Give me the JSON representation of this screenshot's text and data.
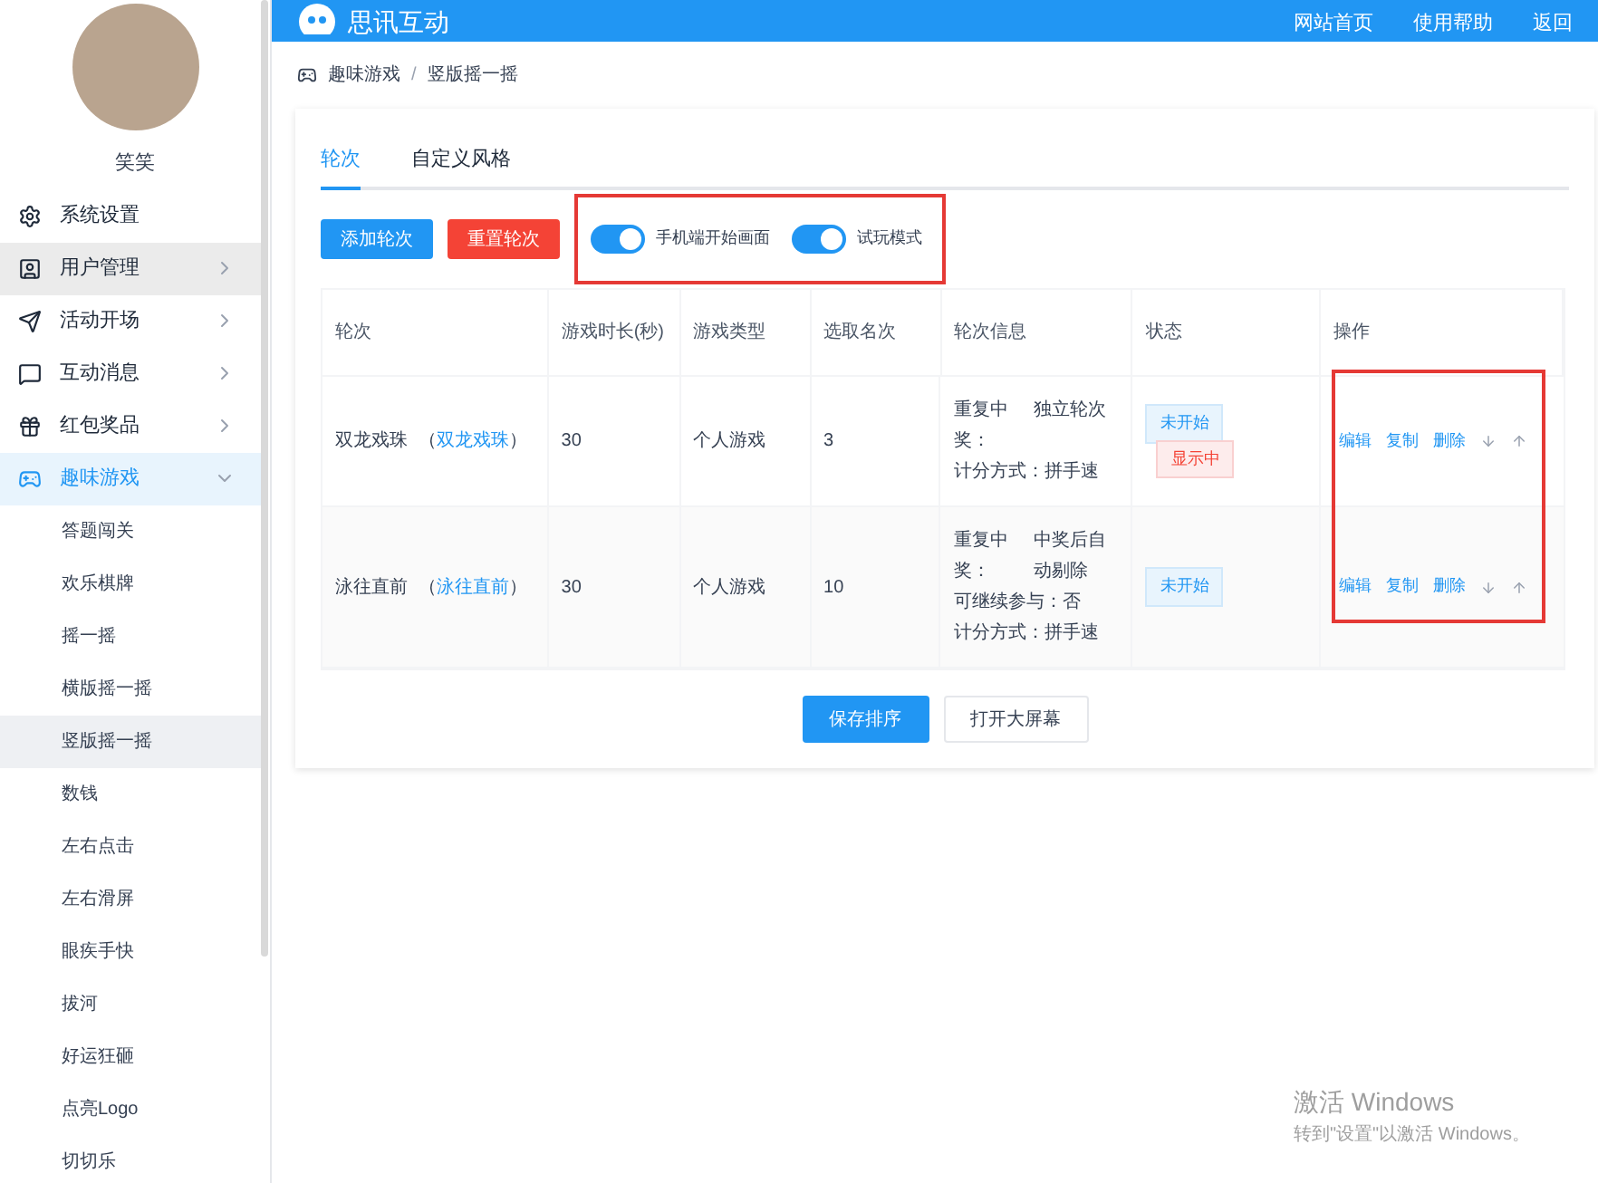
{
  "header": {
    "brand": "思讯互动",
    "links": [
      "网站首页",
      "使用帮助",
      "返回"
    ]
  },
  "sidebar": {
    "user_name": "笑笑",
    "items": [
      {
        "label": "系统设置",
        "kind": "link",
        "selected": false
      },
      {
        "label": "用户管理",
        "kind": "menu",
        "selected": false,
        "hovered": true
      },
      {
        "label": "活动开场",
        "kind": "menu",
        "selected": false
      },
      {
        "label": "互动消息",
        "kind": "menu",
        "selected": false
      },
      {
        "label": "红包奖品",
        "kind": "menu",
        "selected": false
      },
      {
        "label": "趣味游戏",
        "kind": "menu",
        "selected": true,
        "expanded": true,
        "children": [
          {
            "label": "答题闯关",
            "selected": false
          },
          {
            "label": "欢乐棋牌",
            "selected": false
          },
          {
            "label": "摇一摇",
            "selected": false
          },
          {
            "label": "横版摇一摇",
            "selected": false
          },
          {
            "label": "竖版摇一摇",
            "selected": true
          },
          {
            "label": "数钱",
            "selected": false
          },
          {
            "label": "左右点击",
            "selected": false
          },
          {
            "label": "左右滑屏",
            "selected": false
          },
          {
            "label": "眼疾手快",
            "selected": false
          },
          {
            "label": "拔河",
            "selected": false
          },
          {
            "label": "好运狂砸",
            "selected": false
          },
          {
            "label": "点亮Logo",
            "selected": false
          },
          {
            "label": "切切乐",
            "selected": false
          }
        ]
      }
    ]
  },
  "breadcrumb": {
    "separator": "/",
    "items": [
      "趣味游戏",
      "竖版摇一摇"
    ]
  },
  "tabs": [
    {
      "label": "轮次",
      "selected": true
    },
    {
      "label": "自定义风格",
      "selected": false
    }
  ],
  "toolbar": {
    "buttons": [
      {
        "label": "添加轮次",
        "kind": "primary"
      },
      {
        "label": "重置轮次",
        "kind": "danger"
      }
    ],
    "toggles_highlighted": true,
    "toggles": [
      {
        "label": "手机端开始画面",
        "on": true
      },
      {
        "label": "试玩模式",
        "on": true
      }
    ]
  },
  "table": {
    "columns": [
      "轮次",
      "游戏时长(秒)",
      "游戏类型",
      "选取名次",
      "轮次信息",
      "状态",
      "操作"
    ],
    "actions_highlighted": true,
    "rows": [
      {
        "name": "双龙戏珠",
        "link_open": "（",
        "link": "双龙戏珠",
        "link_close": "）",
        "duration": "30",
        "type": "个人游戏",
        "rank": "3",
        "info": [
          {
            "kind": "split",
            "label": "重复中奖：",
            "value": "独立轮次"
          },
          {
            "kind": "inline",
            "label": "计分方式：",
            "value": "拼手速"
          }
        ],
        "status": [
          {
            "label": "未开始",
            "kind": "info"
          },
          {
            "label": "显示中",
            "kind": "danger"
          }
        ],
        "actions": [
          "编辑",
          "复制",
          "删除"
        ]
      },
      {
        "name": "泳往直前",
        "link_open": "（",
        "link": "泳往直前",
        "link_close": "）",
        "duration": "30",
        "type": "个人游戏",
        "rank": "10",
        "info": [
          {
            "kind": "split",
            "label": "重复中奖：",
            "value": "中奖后自动剔除"
          },
          {
            "kind": "inline",
            "label": "可继续参与：",
            "value": "否"
          },
          {
            "kind": "inline",
            "label": "计分方式：",
            "value": "拼手速"
          }
        ],
        "status": [
          {
            "label": "未开始",
            "kind": "info"
          }
        ],
        "actions": [
          "编辑",
          "复制",
          "删除"
        ]
      }
    ]
  },
  "footer_buttons": [
    {
      "label": "保存排序",
      "kind": "primary"
    },
    {
      "label": "打开大屏幕",
      "kind": "default"
    }
  ],
  "os_notice": {
    "title": "激活 Windows",
    "text": "转到\"设置\"以激活 Windows。"
  }
}
